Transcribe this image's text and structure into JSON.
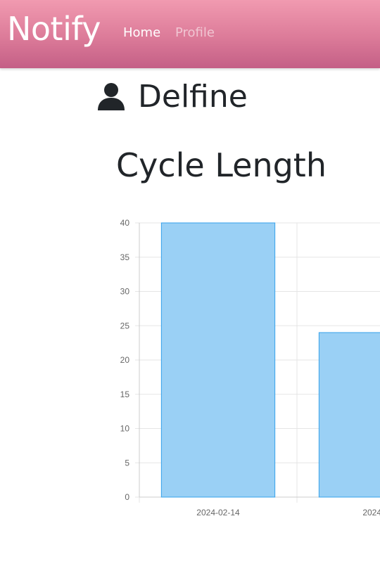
{
  "navbar": {
    "brand": "Notify",
    "links": [
      {
        "label": "Home",
        "active": true
      },
      {
        "label": "Profile",
        "active": false
      }
    ],
    "background_color": "#dc7b99"
  },
  "profile": {
    "icon": "user-icon",
    "name": "Delfine"
  },
  "section": {
    "title": "Cycle Length"
  },
  "chart_data": {
    "type": "bar",
    "title": "",
    "xlabel": "",
    "ylabel": "",
    "categories": [
      "2024-02-14",
      "2024-0"
    ],
    "values": [
      40,
      24
    ],
    "ylim": [
      0,
      40
    ],
    "yticks": [
      0,
      5,
      10,
      15,
      20,
      25,
      30,
      35,
      40
    ],
    "grid": true,
    "bar_fill": "#9ad0f5",
    "bar_stroke": "#36a2eb"
  }
}
